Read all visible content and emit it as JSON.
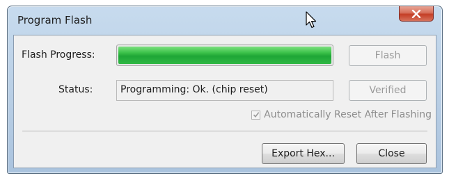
{
  "window": {
    "title": "Program Flash",
    "close_symbol": "x"
  },
  "progress": {
    "label": "Flash Progress:",
    "fraction": 1.0
  },
  "status": {
    "label": "Status:",
    "value": "Programming: Ok. (chip reset)"
  },
  "buttons": {
    "flash": "Flash",
    "verified": "Verified",
    "export_hex": "Export Hex...",
    "close": "Close"
  },
  "options": {
    "auto_reset_label": "Automatically Reset After Flashing",
    "auto_reset_checked": true
  },
  "colors": {
    "progress_green": "#1ea636",
    "close_button_red": "#c43e26",
    "titlebar_blue": "#b7cde4",
    "disabled_text": "#9a9a9a"
  },
  "icons": {
    "close": "close-icon",
    "cursor": "mouse-pointer-icon",
    "check": "checkmark-icon"
  }
}
